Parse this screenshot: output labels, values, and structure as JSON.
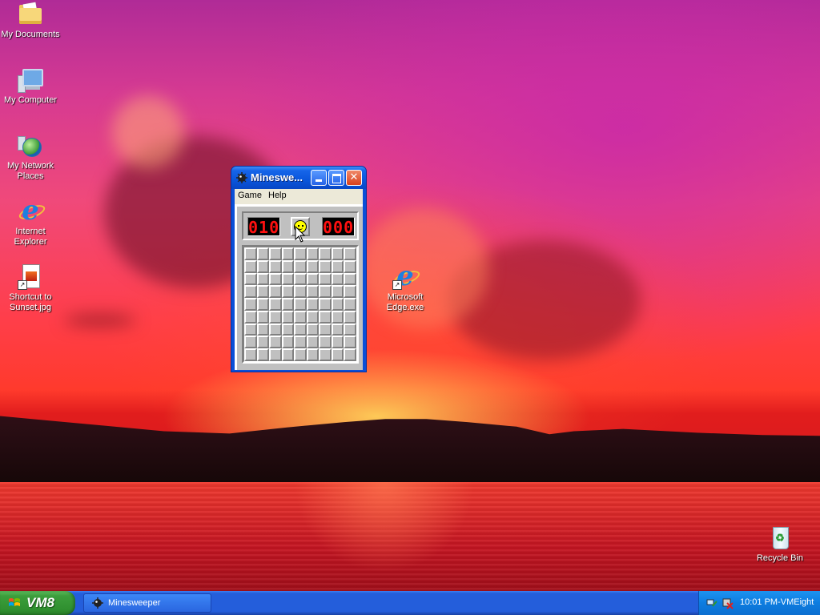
{
  "desktop": {
    "icons": [
      {
        "label": "My Documents"
      },
      {
        "label": "My Computer"
      },
      {
        "label": "My Network Places"
      },
      {
        "label": "Internet Explorer"
      },
      {
        "label": "Shortcut to Sunset.jpg"
      },
      {
        "label": "Microsoft Edge.exe"
      },
      {
        "label": "Recycle Bin"
      }
    ]
  },
  "window": {
    "title": "Mineswe...",
    "menu": [
      "Game",
      "Help"
    ],
    "mine_counter": "010",
    "timer": "000",
    "grid": {
      "rows": 9,
      "cols": 9
    }
  },
  "taskbar": {
    "start_label": "VM8",
    "task_label": "Minesweeper",
    "clock": "10:01 PM-VMEight"
  },
  "colors": {
    "titlebar": "#0a56dc",
    "taskbar": "#245edb",
    "start": "#3c9e3c",
    "lcd_digit": "#ff1010"
  }
}
